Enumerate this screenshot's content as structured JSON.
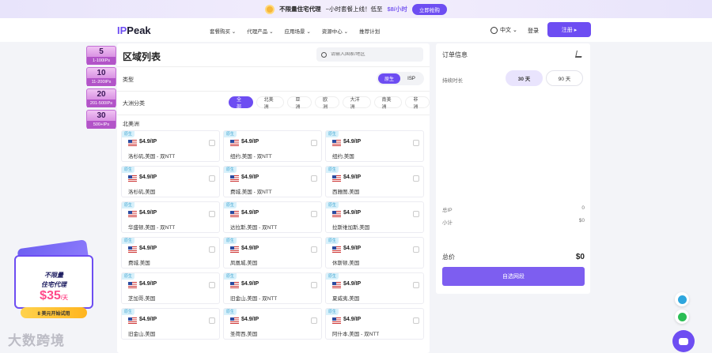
{
  "banner": {
    "text": "不限量住宅代理",
    "text2": "~小时套餐上线！低至",
    "price": "$8/小时",
    "button": "立即抢购"
  },
  "nav": {
    "logo_prefix": "IP",
    "logo_suffix": "Peak",
    "menu": [
      "套餐购买 ⌄",
      "代理产品 ⌄",
      "应用场景 ⌄",
      "资源中心 ⌄",
      "推荐计划"
    ],
    "language": "中文 ⌄",
    "login": "登录",
    "register": "注册 ▸"
  },
  "discounts": [
    {
      "pct": "5",
      "range": "1-100IPs"
    },
    {
      "pct": "10",
      "range": "11-200IPs"
    },
    {
      "pct": "20",
      "range": "201-500IPs"
    },
    {
      "pct": "30",
      "range": "500+IPs"
    }
  ],
  "region": {
    "title": "区域列表",
    "search_placeholder": "请输入国家/地区",
    "type_label": "类型",
    "types": [
      "原生",
      "ISP"
    ],
    "continent_label": "大洲分类",
    "continents": [
      "全部",
      "北美洲",
      "亚洲",
      "欧洲",
      "大洋洲",
      "南美洲",
      "非洲"
    ],
    "section": "北美洲",
    "cards": [
      {
        "tag": "原生",
        "price": "$4.9/IP",
        "loc": "洛杉矶,美国 - 双NTT"
      },
      {
        "tag": "原生",
        "price": "$4.9/IP",
        "loc": "纽约,美国 - 双NTT"
      },
      {
        "tag": "原生",
        "price": "$4.9/IP",
        "loc": "纽约,美国"
      },
      {
        "tag": "原生",
        "price": "$4.9/IP",
        "loc": "洛杉矶,美国"
      },
      {
        "tag": "原生",
        "price": "$4.9/IP",
        "loc": "费城,美国 - 双NTT"
      },
      {
        "tag": "原生",
        "price": "$4.9/IP",
        "loc": "西雅图,美国"
      },
      {
        "tag": "原生",
        "price": "$4.9/IP",
        "loc": "华盛顿,美国 - 双NTT"
      },
      {
        "tag": "原生",
        "price": "$4.9/IP",
        "loc": "达拉斯,美国 - 双NTT"
      },
      {
        "tag": "原生",
        "price": "$4.9/IP",
        "loc": "拉斯维加斯,美国"
      },
      {
        "tag": "原生",
        "price": "$4.9/IP",
        "loc": "费城,美国"
      },
      {
        "tag": "原生",
        "price": "$4.9/IP",
        "loc": "凤凰城,美国"
      },
      {
        "tag": "原生",
        "price": "$4.9/IP",
        "loc": "休斯顿,美国"
      },
      {
        "tag": "原生",
        "price": "$4.9/IP",
        "loc": "芝加哥,美国"
      },
      {
        "tag": "原生",
        "price": "$4.9/IP",
        "loc": "旧金山,美国 - 双NTT"
      },
      {
        "tag": "原生",
        "price": "$4.9/IP",
        "loc": "夏威夷,美国"
      },
      {
        "tag": "原生",
        "price": "$4.9/IP",
        "loc": "旧金山,美国"
      },
      {
        "tag": "原生",
        "price": "$4.9/IP",
        "loc": "圣荷西,美国"
      },
      {
        "tag": "原生",
        "price": "$4.9/IP",
        "loc": "阿什本,美国 - 双NTT"
      }
    ]
  },
  "order": {
    "title": "订单信息",
    "duration_label": "持续时长",
    "durations": [
      "30 天",
      "90 天"
    ],
    "total_ip_label": "总IP",
    "total_ip": "0",
    "subtotal_label": "小计",
    "subtotal": "$0",
    "total_label": "总价",
    "total": "$0",
    "buy": "自选网段"
  },
  "promo": {
    "line1": "不限量",
    "line2": "住宅代理",
    "price": "$35",
    "unit": "/天",
    "trial": "8 美元开始试用"
  },
  "watermark": "大数跨境"
}
